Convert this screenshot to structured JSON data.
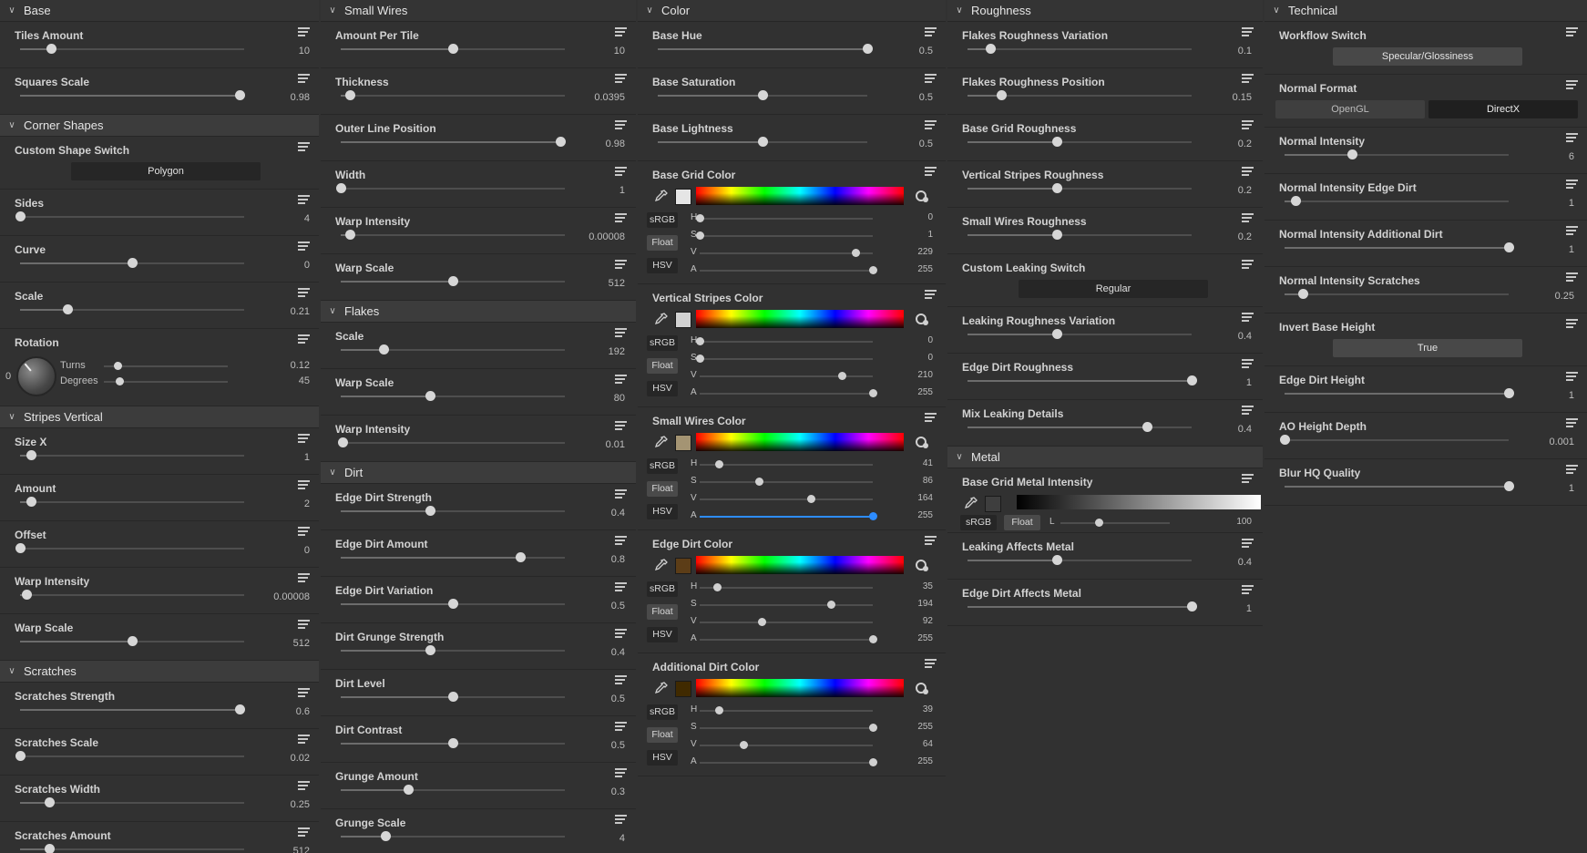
{
  "columns": [
    {
      "sections": [
        {
          "title": "Base",
          "params": [
            {
              "label": "Tiles Amount",
              "value": "10",
              "frac": 0.14
            },
            {
              "label": "Squares Scale",
              "value": "0.98",
              "frac": 0.98
            }
          ]
        },
        {
          "title": "Corner Shapes",
          "params": [
            {
              "label": "Custom Shape Switch",
              "dropdown": "Polygon"
            },
            {
              "label": "Sides",
              "value": "4",
              "frac": 0.0
            },
            {
              "label": "Curve",
              "value": "0",
              "frac": 0.5
            },
            {
              "label": "Scale",
              "value": "0.21",
              "frac": 0.21
            },
            {
              "label": "Rotation",
              "rotation": {
                "dial_value": "0",
                "turns_label": "Turns",
                "turns_value": "0.12",
                "turns_frac": 0.12,
                "degrees_label": "Degrees",
                "degrees_value": "45",
                "degrees_frac": 0.13
              }
            }
          ]
        },
        {
          "title": "Stripes Vertical",
          "params": [
            {
              "label": "Size X",
              "value": "1",
              "frac": 0.05
            },
            {
              "label": "Amount",
              "value": "2",
              "frac": 0.05
            },
            {
              "label": "Offset",
              "value": "0",
              "frac": 0.0
            },
            {
              "label": "Warp Intensity",
              "value": "0.00008",
              "frac": 0.03
            },
            {
              "label": "Warp Scale",
              "value": "512",
              "frac": 0.5
            }
          ]
        },
        {
          "title": "Scratches",
          "params": [
            {
              "label": "Scratches Strength",
              "value": "0.6",
              "frac": 0.98
            },
            {
              "label": "Scratches Scale",
              "value": "0.02",
              "frac": 0.0
            },
            {
              "label": "Scratches Width",
              "value": "0.25",
              "frac": 0.13
            },
            {
              "label": "Scratches Amount",
              "value": "512",
              "frac": 0.13
            }
          ]
        }
      ]
    },
    {
      "sections": [
        {
          "title": "Small Wires",
          "params": [
            {
              "label": "Amount Per Tile",
              "value": "10",
              "frac": 0.5
            },
            {
              "label": "Thickness",
              "value": "0.0395",
              "frac": 0.04
            },
            {
              "label": "Outer Line Position",
              "value": "0.98",
              "frac": 0.98
            },
            {
              "label": "Width",
              "value": "1",
              "frac": 0.0
            },
            {
              "label": "Warp Intensity",
              "value": "0.00008",
              "frac": 0.04
            },
            {
              "label": "Warp Scale",
              "value": "512",
              "frac": 0.5
            }
          ]
        },
        {
          "title": "Flakes",
          "params": [
            {
              "label": "Scale",
              "value": "192",
              "frac": 0.19
            },
            {
              "label": "Warp Scale",
              "value": "80",
              "frac": 0.4
            },
            {
              "label": "Warp Intensity",
              "value": "0.01",
              "frac": 0.01
            }
          ]
        },
        {
          "title": "Dirt",
          "params": [
            {
              "label": "Edge Dirt Strength",
              "value": "0.4",
              "frac": 0.4
            },
            {
              "label": "Edge Dirt Amount",
              "value": "0.8",
              "frac": 0.8
            },
            {
              "label": "Edge Dirt Variation",
              "value": "0.5",
              "frac": 0.5
            },
            {
              "label": "Dirt Grunge Strength",
              "value": "0.4",
              "frac": 0.4
            },
            {
              "label": "Dirt Level",
              "value": "0.5",
              "frac": 0.5
            },
            {
              "label": "Dirt Contrast",
              "value": "0.5",
              "frac": 0.5
            },
            {
              "label": "Grunge Amount",
              "value": "0.3",
              "frac": 0.3
            },
            {
              "label": "Grunge Scale",
              "value": "4",
              "frac": 0.2
            }
          ]
        }
      ]
    },
    {
      "sections": [
        {
          "title": "Color",
          "params": [
            {
              "label": "Base Hue",
              "value": "0.5",
              "frac": 1.0
            },
            {
              "label": "Base Saturation",
              "value": "0.5",
              "frac": 0.5
            },
            {
              "label": "Base Lightness",
              "value": "0.5",
              "frac": 0.5
            },
            {
              "label": "Base Grid Color",
              "color": {
                "swatch": "#e5e5e5",
                "modes": [
                  "sRGB",
                  "Float",
                  "HSV"
                ],
                "channels": [
                  {
                    "name": "H",
                    "value": "0",
                    "frac": 0.0
                  },
                  {
                    "name": "S",
                    "value": "1",
                    "frac": 0.0
                  },
                  {
                    "name": "V",
                    "value": "229",
                    "frac": 0.9
                  },
                  {
                    "name": "A",
                    "value": "255",
                    "frac": 1.0
                  }
                ]
              }
            },
            {
              "label": "Vertical Stripes Color",
              "color": {
                "swatch": "#d2d2d2",
                "modes": [
                  "sRGB",
                  "Float",
                  "HSV"
                ],
                "channels": [
                  {
                    "name": "H",
                    "value": "0",
                    "frac": 0.0
                  },
                  {
                    "name": "S",
                    "value": "0",
                    "frac": 0.0
                  },
                  {
                    "name": "V",
                    "value": "210",
                    "frac": 0.82
                  },
                  {
                    "name": "A",
                    "value": "255",
                    "frac": 1.0
                  }
                ]
              }
            },
            {
              "label": "Small Wires Color",
              "color": {
                "swatch": "#a49473",
                "modes": [
                  "sRGB",
                  "Float",
                  "HSV"
                ],
                "channels": [
                  {
                    "name": "H",
                    "value": "41",
                    "frac": 0.11
                  },
                  {
                    "name": "S",
                    "value": "86",
                    "frac": 0.34
                  },
                  {
                    "name": "V",
                    "value": "164",
                    "frac": 0.64
                  },
                  {
                    "name": "A",
                    "value": "255",
                    "frac": 1.0,
                    "accent": true
                  }
                ]
              }
            },
            {
              "label": "Edge Dirt Color",
              "color": {
                "swatch": "#5c3d17",
                "modes": [
                  "sRGB",
                  "Float",
                  "HSV"
                ],
                "channels": [
                  {
                    "name": "H",
                    "value": "35",
                    "frac": 0.1
                  },
                  {
                    "name": "S",
                    "value": "194",
                    "frac": 0.76
                  },
                  {
                    "name": "V",
                    "value": "92",
                    "frac": 0.36
                  },
                  {
                    "name": "A",
                    "value": "255",
                    "frac": 1.0
                  }
                ]
              }
            },
            {
              "label": "Additional Dirt Color",
              "color": {
                "swatch": "#402a00",
                "modes": [
                  "sRGB",
                  "Float",
                  "HSV"
                ],
                "channels": [
                  {
                    "name": "H",
                    "value": "39",
                    "frac": 0.11
                  },
                  {
                    "name": "S",
                    "value": "255",
                    "frac": 1.0
                  },
                  {
                    "name": "V",
                    "value": "64",
                    "frac": 0.25
                  },
                  {
                    "name": "A",
                    "value": "255",
                    "frac": 1.0
                  }
                ]
              }
            }
          ]
        }
      ]
    },
    {
      "sections": [
        {
          "title": "Roughness",
          "params": [
            {
              "label": "Flakes Roughness Variation",
              "value": "0.1",
              "frac": 0.1
            },
            {
              "label": "Flakes Roughness Position",
              "value": "0.15",
              "frac": 0.15
            },
            {
              "label": "Base Grid Roughness",
              "value": "0.2",
              "frac": 0.4
            },
            {
              "label": "Vertical Stripes Roughness",
              "value": "0.2",
              "frac": 0.4
            },
            {
              "label": "Small Wires Roughness",
              "value": "0.2",
              "frac": 0.4
            },
            {
              "label": "Custom Leaking Switch",
              "dropdown": "Regular"
            },
            {
              "label": "Leaking Roughness Variation",
              "value": "0.4",
              "frac": 0.4
            },
            {
              "label": "Edge Dirt Roughness",
              "value": "1",
              "frac": 1.0
            },
            {
              "label": "Mix Leaking Details",
              "value": "0.4",
              "frac": 0.8
            }
          ]
        },
        {
          "title": "Metal",
          "params": [
            {
              "label": "Base Grid Metal Intensity",
              "grey": {
                "swatch": "#3e3e3e",
                "modes": [
                  "sRGB",
                  "Float"
                ],
                "channel": "L",
                "value": "100",
                "frac": 0.35
              }
            },
            {
              "label": "Leaking Affects Metal",
              "value": "0.4",
              "frac": 0.4
            },
            {
              "label": "Edge Dirt Affects Metal",
              "value": "1",
              "frac": 1.0
            }
          ]
        }
      ]
    },
    {
      "sections": [
        {
          "title": "Technical",
          "params": [
            {
              "label": "Workflow Switch",
              "dropdown": "Specular/Glossiness"
            },
            {
              "label": "Normal Format",
              "toggle": [
                "OpenGL",
                "DirectX"
              ]
            },
            {
              "label": "Normal Intensity",
              "value": "6",
              "frac": 0.3
            },
            {
              "label": "Normal Intensity Edge Dirt",
              "value": "1",
              "frac": 0.05
            },
            {
              "label": "Normal Intensity Additional Dirt",
              "value": "1",
              "frac": 1.0
            },
            {
              "label": "Normal Intensity Scratches",
              "value": "0.25",
              "frac": 0.08
            },
            {
              "label": "Invert Base Height",
              "dropdown": "True"
            },
            {
              "label": "Edge Dirt Height",
              "value": "1",
              "frac": 1.0
            },
            {
              "label": "AO Height Depth",
              "value": "0.001",
              "frac": 0.0
            },
            {
              "label": "Blur HQ Quality",
              "value": "1",
              "frac": 1.0
            }
          ]
        }
      ]
    }
  ],
  "colors": {
    "accent": "#2d8cff",
    "panel": "#313131",
    "header": "#3c3c3c"
  },
  "icons": {
    "menu": "menu-icon",
    "chevron": "chevron-down-icon",
    "eyedropper": "eyedropper-icon",
    "reset": "reset-color-icon"
  }
}
